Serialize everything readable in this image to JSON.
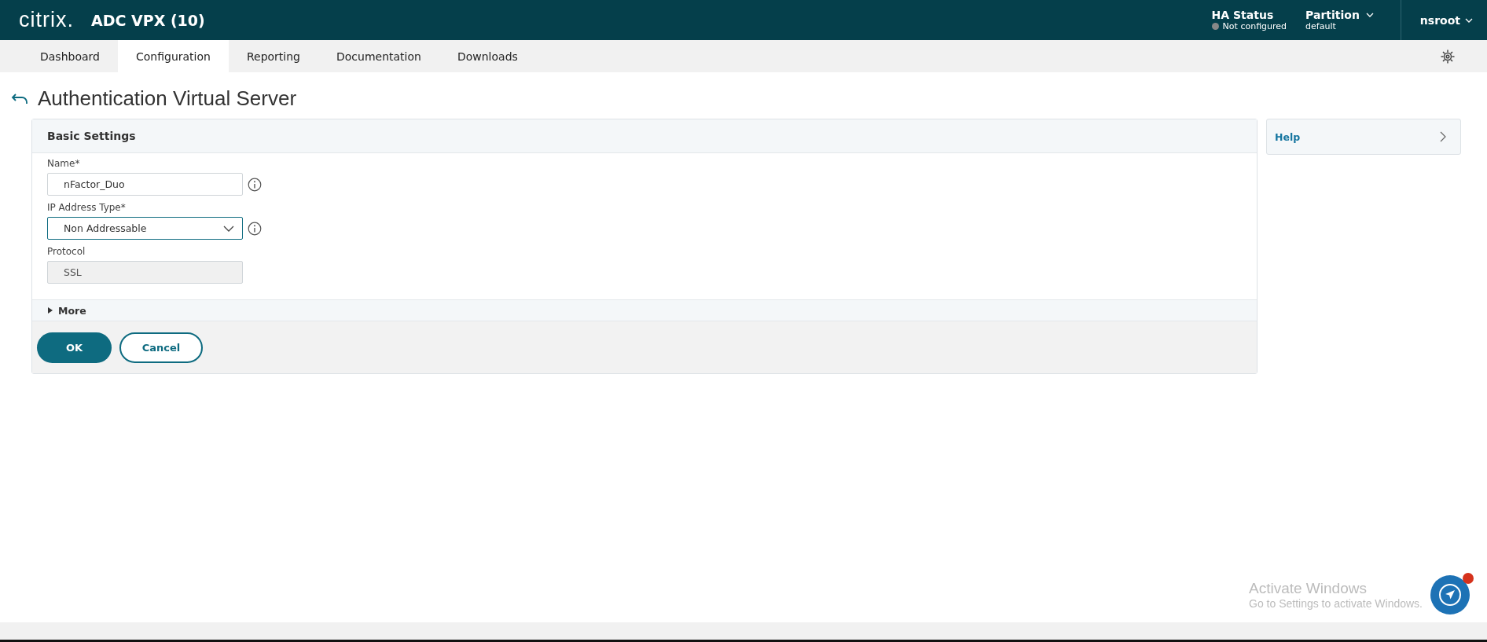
{
  "header": {
    "logo": "citrix.",
    "product": "ADC VPX (10)",
    "ha_status": {
      "label": "HA Status",
      "value": "Not configured"
    },
    "partition": {
      "label": "Partition",
      "value": "default"
    },
    "user": "nsroot"
  },
  "tabs": [
    {
      "label": "Dashboard",
      "selected": false
    },
    {
      "label": "Configuration",
      "selected": true
    },
    {
      "label": "Reporting",
      "selected": false
    },
    {
      "label": "Documentation",
      "selected": false
    },
    {
      "label": "Downloads",
      "selected": false
    }
  ],
  "page_title": "Authentication Virtual Server",
  "panel": {
    "title": "Basic Settings",
    "fields": [
      {
        "kind": "text",
        "label": "Name*",
        "value": "nFactor_Duo",
        "info": true,
        "disabled": false
      },
      {
        "kind": "select",
        "label": "IP Address Type*",
        "value": "Non Addressable",
        "info": true,
        "disabled": false
      },
      {
        "kind": "text",
        "label": "Protocol",
        "value": "SSL",
        "info": false,
        "disabled": true
      }
    ],
    "more": {
      "label": "More",
      "expanded": false
    },
    "buttons": [
      {
        "label": "OK",
        "kind": "primary"
      },
      {
        "label": "Cancel",
        "kind": "secondary"
      }
    ]
  },
  "help": {
    "label": "Help"
  },
  "activation": {
    "title": "Activate Windows",
    "text": "Go to Settings to activate Windows."
  }
}
